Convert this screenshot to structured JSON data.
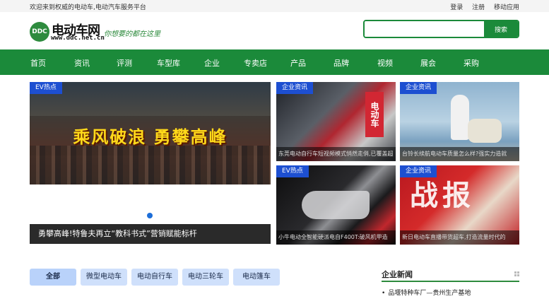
{
  "topbar": {
    "welcome": "欢迎来到权威的电动车,电动汽车服务平台",
    "login": "登录",
    "register": "注册",
    "mobile": "移动应用"
  },
  "logo": {
    "badge": "DDC",
    "name": "电动车网",
    "domain": "www.ddc.net.cn",
    "slogan": "你想要的都在这里"
  },
  "search": {
    "placeholder": "",
    "button": "搜索"
  },
  "nav": [
    "首页",
    "资讯",
    "评测",
    "车型库",
    "企业",
    "专卖店",
    "产品",
    "品牌",
    "视频",
    "展会",
    "采购"
  ],
  "hero": {
    "tag": "EV热点",
    "headline": "乘风破浪 勇攀高峰",
    "caption": "勇攀高峰!特鲁夫再立“教科书式”营销赋能标杆"
  },
  "tiles": [
    {
      "tag": "企业资讯",
      "sign": "电动车",
      "caption": "东莞电动自行车短视频模式悄然走俏,已覆盖超"
    },
    {
      "tag": "企业资讯",
      "caption": "台铃长续航电动车质量怎么样?强实力造就"
    },
    {
      "tag": "EV热点",
      "caption": "小牛电动全智能硬派电自F400T:破风机甲造"
    },
    {
      "tag": "企业资讯",
      "big": "战报",
      "caption": "新日电动车直播带货超车,打造流量时代的"
    }
  ],
  "filters": [
    "全部",
    "微型电动车",
    "电动自行车",
    "电动三轮车",
    "电动篷车"
  ],
  "side": {
    "title": "企业新闻",
    "items": [
      "品堰特种车厂—贵州生产基地"
    ]
  },
  "colors": {
    "brand_green": "#1b8a3a",
    "tag_blue": "#1d4fd1",
    "headline_yellow": "#ffd91a"
  }
}
